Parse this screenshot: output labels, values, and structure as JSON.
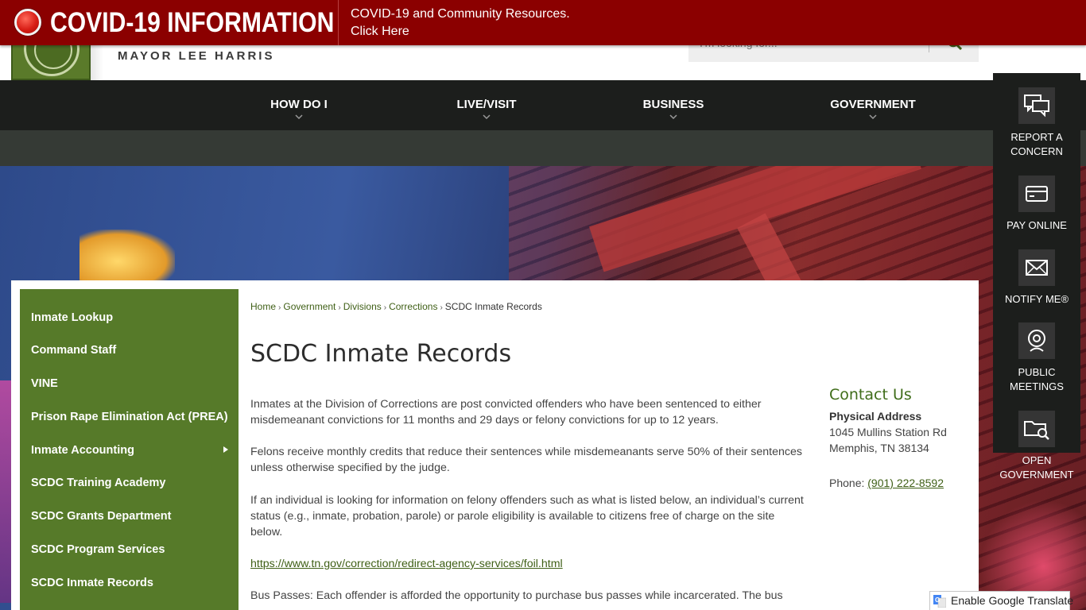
{
  "alert": {
    "title": "COVID-19 INFORMATION",
    "line1": "COVID-19 and Community Resources.",
    "line2": "Click Here"
  },
  "header": {
    "mayor": "MAYOR LEE HARRIS",
    "search_placeholder": "I'm looking for..."
  },
  "nav": {
    "items": [
      "HOW DO I",
      "LIVE/VISIT",
      "BUSINESS",
      "GOVERNMENT"
    ]
  },
  "sidebar": {
    "items": [
      "Inmate Lookup",
      "Command Staff",
      "VINE",
      "Prison Rape Elimination Act (PREA)",
      "Inmate Accounting",
      "SCDC Training Academy",
      "SCDC Grants Department",
      "SCDC Program Services",
      "SCDC Inmate Records"
    ]
  },
  "breadcrumb": [
    "Home",
    "Government",
    "Divisions",
    "Corrections",
    "SCDC Inmate Records"
  ],
  "page": {
    "title": "SCDC Inmate Records",
    "p1": "Inmates at the Division of Corrections are post convicted offenders who have been sentenced to either misdemeanant convictions for 11 months and 29 days or felony convictions for up to 12 years.",
    "p2": "Felons receive monthly credits that reduce their sentences while misdemeanants serve 50% of their sentences unless otherwise specified by the judge.",
    "p3": "If an individual is looking for information on felony offenders such as what is listed below, an individual’s current status (e.g., inmate, probation, parole) or parole eligibility is available to citizens free of charge on the site below.",
    "link": "https://www.tn.gov/correction/redirect-agency-services/foil.html",
    "p4": "Bus Passes: Each offender is afforded the opportunity to purchase bus passes while incarcerated.  The bus"
  },
  "contact": {
    "heading": "Contact Us",
    "label": "Physical Address",
    "address1": "1045 Mullins Station Rd",
    "address2": "Memphis, TN 38134",
    "phone_label": "Phone: ",
    "phone": "(901) 222-8592"
  },
  "rail": {
    "items": [
      {
        "l1": "REPORT A",
        "l2": "CONCERN",
        "icon": "chat-icon"
      },
      {
        "l1": "PAY ONLINE",
        "l2": "",
        "icon": "card-icon"
      },
      {
        "l1": "NOTIFY ME®",
        "l2": "",
        "icon": "mail-icon"
      },
      {
        "l1": "PUBLIC",
        "l2": "MEETINGS",
        "icon": "webcam-icon"
      },
      {
        "l1": "OPEN",
        "l2": "GOVERNMENT",
        "icon": "folder-search-icon"
      }
    ]
  },
  "translate": {
    "label": "Enable Google Translate"
  },
  "colors": {
    "alert_red": "#8b0000",
    "sidebar_green": "#567a29",
    "nav_dark": "#1c1e1c",
    "link_green": "#3f5f16"
  }
}
